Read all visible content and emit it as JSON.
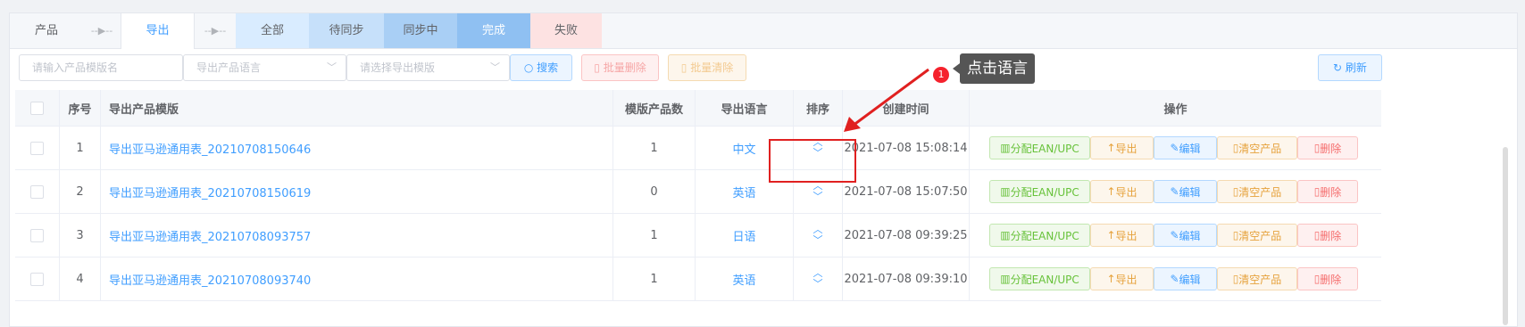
{
  "tabs": [
    {
      "label": "产品",
      "type": "plain"
    },
    {
      "label": "--▶--",
      "type": "flag"
    },
    {
      "label": "导出",
      "type": "active"
    },
    {
      "label": "--▶--",
      "type": "flag"
    },
    {
      "label": "全部",
      "type": "c-all"
    },
    {
      "label": "待同步",
      "type": "c-wait"
    },
    {
      "label": "同步中",
      "type": "c-sync"
    },
    {
      "label": "完成",
      "type": "c-done"
    },
    {
      "label": "失败",
      "type": "c-fail"
    }
  ],
  "toolbar": {
    "template_name_placeholder": "请输入产品模版名",
    "language_placeholder": "导出产品语言",
    "template_placeholder": "请选择导出模版",
    "search_label": "搜索",
    "batch_delete_label": "批量删除",
    "batch_clear_label": "批量清除",
    "refresh_label": "刷新"
  },
  "annotation": {
    "badge": "1",
    "text": "点击语言"
  },
  "table": {
    "headers": {
      "index": "序号",
      "template": "导出产品模版",
      "count": "模版产品数",
      "language": "导出语言",
      "sort": "排序",
      "created": "创建时间",
      "actions": "操作"
    },
    "rows": [
      {
        "index": "1",
        "template": "导出亚马逊通用表_20210708150646",
        "count": "1",
        "language": "中文",
        "created": "2021-07-08 15:08:14"
      },
      {
        "index": "2",
        "template": "导出亚马逊通用表_20210708150619",
        "count": "0",
        "language": "英语",
        "created": "2021-07-08 15:07:50"
      },
      {
        "index": "3",
        "template": "导出亚马逊通用表_20210708093757",
        "count": "1",
        "language": "日语",
        "created": "2021-07-08 09:39:25"
      },
      {
        "index": "4",
        "template": "导出亚马逊通用表_20210708093740",
        "count": "1",
        "language": "英语",
        "created": "2021-07-08 09:39:10"
      }
    ],
    "actions": {
      "ean": "分配EAN/UPC",
      "export": "导出",
      "edit": "编辑",
      "clear": "清空产品",
      "delete": "删除"
    }
  },
  "colors": {
    "primary": "#409eff",
    "danger": "#f56c6c",
    "warning": "#e6a23c",
    "success": "#67c23a"
  }
}
